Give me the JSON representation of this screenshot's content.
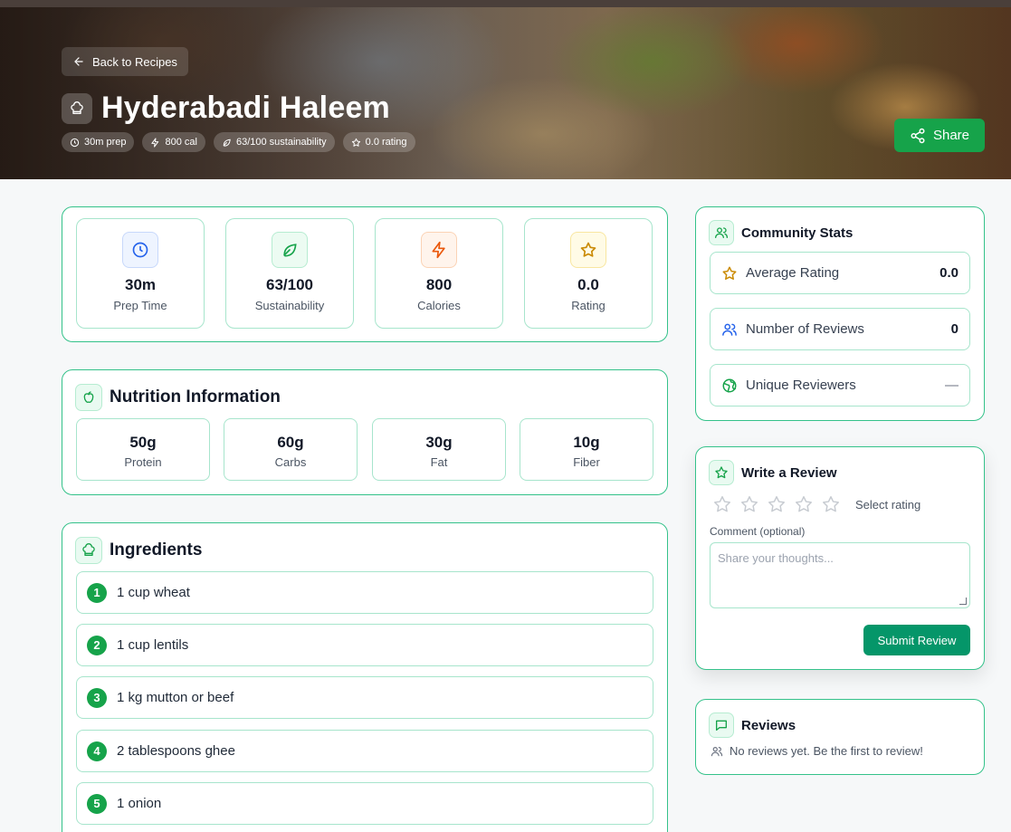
{
  "hero": {
    "back_label": "Back to Recipes",
    "title": "Hyderabadi Haleem",
    "chips": {
      "prep": "30m prep",
      "calories": "800 cal",
      "sustainability": "63/100 sustainability",
      "rating": "0.0 rating"
    },
    "share_label": "Share"
  },
  "stats": [
    {
      "value": "30m",
      "label": "Prep Time",
      "icon": "clock-icon",
      "color": "#2563eb",
      "bg": "#eef4ff"
    },
    {
      "value": "63/100",
      "label": "Sustainability",
      "icon": "leaf-icon",
      "color": "#16a34a",
      "bg": "#ecfbf2"
    },
    {
      "value": "800",
      "label": "Calories",
      "icon": "zap-icon",
      "color": "#ea580c",
      "bg": "#fff4ec"
    },
    {
      "value": "0.0",
      "label": "Rating",
      "icon": "star-icon",
      "color": "#ca8a04",
      "bg": "#fffbe6"
    }
  ],
  "nutrition": {
    "title": "Nutrition Information",
    "items": [
      {
        "value": "50g",
        "label": "Protein"
      },
      {
        "value": "60g",
        "label": "Carbs"
      },
      {
        "value": "30g",
        "label": "Fat"
      },
      {
        "value": "10g",
        "label": "Fiber"
      }
    ]
  },
  "ingredients": {
    "title": "Ingredients",
    "items": [
      {
        "num": "1",
        "text": "1 cup wheat"
      },
      {
        "num": "2",
        "text": "1 cup lentils"
      },
      {
        "num": "3",
        "text": "1 kg mutton or beef"
      },
      {
        "num": "4",
        "text": "2 tablespoons ghee"
      },
      {
        "num": "5",
        "text": "1 onion"
      }
    ]
  },
  "community": {
    "title": "Community Stats",
    "average_rating_label": "Average Rating",
    "average_rating_value": "0.0",
    "num_reviews_label": "Number of Reviews",
    "num_reviews_value": "0",
    "unique_reviewers_label": "Unique Reviewers",
    "unique_reviewers_value": "—"
  },
  "write_review": {
    "title": "Write a Review",
    "select_rating": "Select rating",
    "rating_stars": 0,
    "comment_label": "Comment (optional)",
    "comment_placeholder": "Share your thoughts...",
    "submit_label": "Submit Review"
  },
  "reviews": {
    "title": "Reviews",
    "empty_text": "No reviews yet. Be the first to review!"
  },
  "colors": {
    "accent": "#16a34a",
    "border": "#34c28a",
    "submit": "#059669"
  }
}
